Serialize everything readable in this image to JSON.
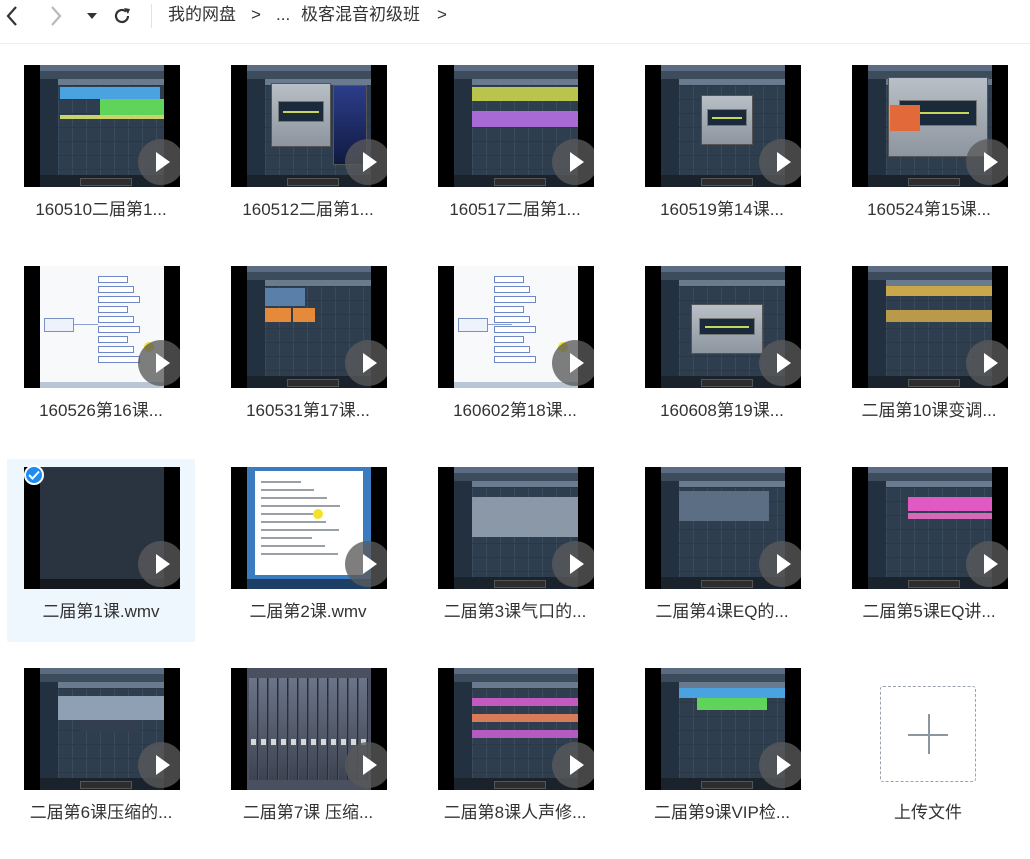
{
  "breadcrumb": {
    "root": "我的网盘",
    "sep": ">",
    "ellipsis": "...",
    "current": "极客混音初级班"
  },
  "files": [
    {
      "name": "160510二届第1...",
      "theme": "daw-green"
    },
    {
      "name": "160512二届第1...",
      "theme": "daw-plugin"
    },
    {
      "name": "160517二届第1...",
      "theme": "daw-purple"
    },
    {
      "name": "160519第14课...",
      "theme": "daw-dialog"
    },
    {
      "name": "160524第15课...",
      "theme": "daw-plugin2"
    },
    {
      "name": "160526第16课...",
      "theme": "mindmap"
    },
    {
      "name": "160531第17课...",
      "theme": "daw-orange"
    },
    {
      "name": "160602第18课...",
      "theme": "mindmap2"
    },
    {
      "name": "160608第19课...",
      "theme": "daw-mixplugin"
    },
    {
      "name": "二届第10课变调...",
      "theme": "daw-wave"
    },
    {
      "name": "二届第1课.wmv",
      "theme": "dark",
      "selected": true
    },
    {
      "name": "二届第2课.wmv",
      "theme": "doc"
    },
    {
      "name": "二届第3课气口的...",
      "theme": "daw-gray"
    },
    {
      "name": "二届第4课EQ的...",
      "theme": "daw-tracks"
    },
    {
      "name": "二届第5课EQ讲...",
      "theme": "daw-pink"
    },
    {
      "name": "二届第6课压缩的...",
      "theme": "daw-edit"
    },
    {
      "name": "二届第7课 压缩...",
      "theme": "mixer"
    },
    {
      "name": "二届第8课人声修...",
      "theme": "daw-multi"
    },
    {
      "name": "二届第9课VIP检...",
      "theme": "daw-green2"
    }
  ],
  "upload": {
    "label": "上传文件",
    "icon": "plus-icon"
  },
  "icons": {
    "back": "chevron-left-icon",
    "forward": "chevron-right-icon",
    "dropdown": "caret-down-icon",
    "refresh": "refresh-icon",
    "play": "play-icon",
    "check": "check-icon"
  },
  "colors": {
    "accent": "#1e8bf2",
    "selected_bg": "#eef6fe"
  }
}
